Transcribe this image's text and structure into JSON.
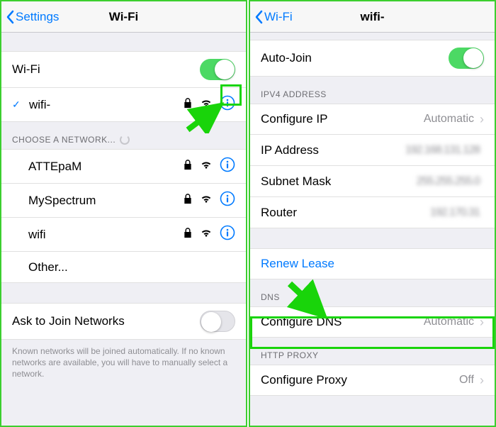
{
  "left": {
    "nav": {
      "back": "Settings",
      "title": "Wi-Fi"
    },
    "wifi_row": {
      "label": "Wi-Fi",
      "on": true
    },
    "connected": {
      "name": "wifi-"
    },
    "choose_header": "CHOOSE A NETWORK...",
    "networks": [
      {
        "name": "ATTEpaM"
      },
      {
        "name": "MySpectrum"
      },
      {
        "name": "wifi"
      }
    ],
    "other": "Other...",
    "ask": {
      "label": "Ask to Join Networks",
      "on": false
    },
    "footer": "Known networks will be joined automatically. If no known networks are available, you will have to manually select a network."
  },
  "right": {
    "nav": {
      "back": "Wi-Fi",
      "title": "wifi-"
    },
    "autojoin": {
      "label": "Auto-Join",
      "on": true
    },
    "ipv4_header": "IPV4 ADDRESS",
    "configure_ip": {
      "label": "Configure IP",
      "value": "Automatic"
    },
    "ip_address": {
      "label": "IP Address",
      "value": "192.168.131.128"
    },
    "subnet": {
      "label": "Subnet Mask",
      "value": "255.255.255.0"
    },
    "router": {
      "label": "Router",
      "value": "192.170.31"
    },
    "renew": "Renew Lease",
    "dns_header": "DNS",
    "configure_dns": {
      "label": "Configure DNS",
      "value": "Automatic"
    },
    "proxy_header": "HTTP PROXY",
    "configure_proxy": {
      "label": "Configure Proxy",
      "value": "Off"
    }
  }
}
